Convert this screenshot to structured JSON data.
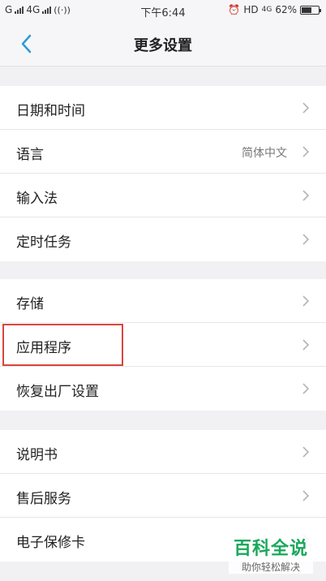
{
  "status_bar": {
    "carrier_1": "G",
    "carrier_2": "4G",
    "time": "下午6:44",
    "network": "HD",
    "network_gen": "4G",
    "battery_percent": "62%",
    "battery_level": 0.62
  },
  "header": {
    "title": "更多设置"
  },
  "groups": [
    {
      "items": [
        {
          "label": "日期和时间"
        },
        {
          "label": "语言",
          "value": "简体中文"
        },
        {
          "label": "输入法"
        },
        {
          "label": "定时任务"
        }
      ]
    },
    {
      "items": [
        {
          "label": "存储"
        },
        {
          "label": "应用程序"
        },
        {
          "label": "恢复出厂设置"
        }
      ]
    },
    {
      "items": [
        {
          "label": "说明书"
        },
        {
          "label": "售后服务"
        },
        {
          "label": "电子保修卡"
        }
      ]
    }
  ],
  "watermark": {
    "title": "百科全说",
    "subtitle": "助你轻松解决"
  },
  "colors": {
    "accent": "#2d9bd8",
    "highlight": "#d9453f",
    "watermark": "#1aa85a"
  }
}
